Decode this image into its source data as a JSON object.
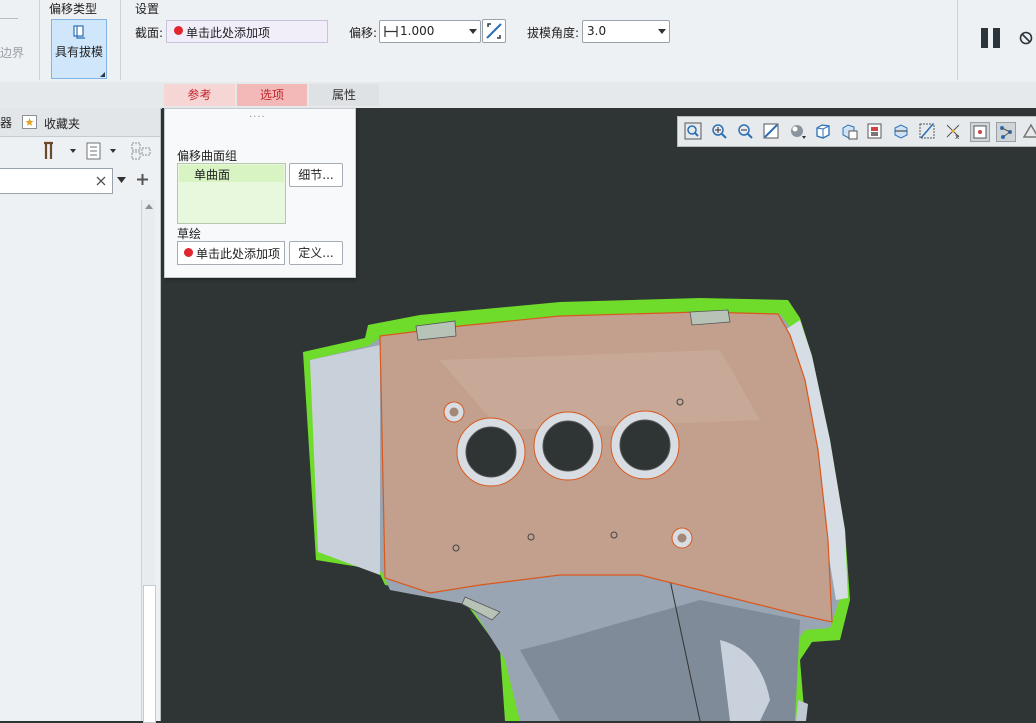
{
  "ribbon": {
    "left_cut_label": "边界",
    "offset_type": {
      "title": "偏移类型",
      "button_label": "具有拔模"
    },
    "settings": {
      "title": "设置",
      "surface_label": "截面:",
      "surface_placeholder": "单击此处添加项",
      "offset_label": "偏移:",
      "offset_value": "1.000",
      "draft_angle_label": "拔模角度:",
      "draft_angle_value": "3.0"
    }
  },
  "tabs": [
    {
      "label": "参考"
    },
    {
      "label": "选项"
    },
    {
      "label": "属性"
    }
  ],
  "left_panel": {
    "tab_cut_label": "器",
    "favorites_label": "收藏夹"
  },
  "popup": {
    "grip": "....",
    "offset_group_label": "偏移曲面组",
    "surface_item": "单曲面",
    "details_button": "细节...",
    "sketch_label": "草绘",
    "sketch_placeholder": "单击此处添加项",
    "define_button": "定义..."
  },
  "view_toolbar": {
    "icons": [
      "refit-icon",
      "zoom-in-icon",
      "zoom-out-icon",
      "repaint-icon",
      "display-style-icon",
      "saved-views-icon",
      "view-manager-icon",
      "perspective-icon",
      "section-icon",
      "datum-display-icon",
      "annotation-display-icon",
      "spin-center-icon",
      "selected-display-icon",
      "datum-planes-icon"
    ]
  },
  "colors": {
    "accent_red": "#e0262e",
    "selected_green": "#6fdb2a",
    "surface_tan": "#c3a08e",
    "viewport_bg": "#2f3535"
  }
}
